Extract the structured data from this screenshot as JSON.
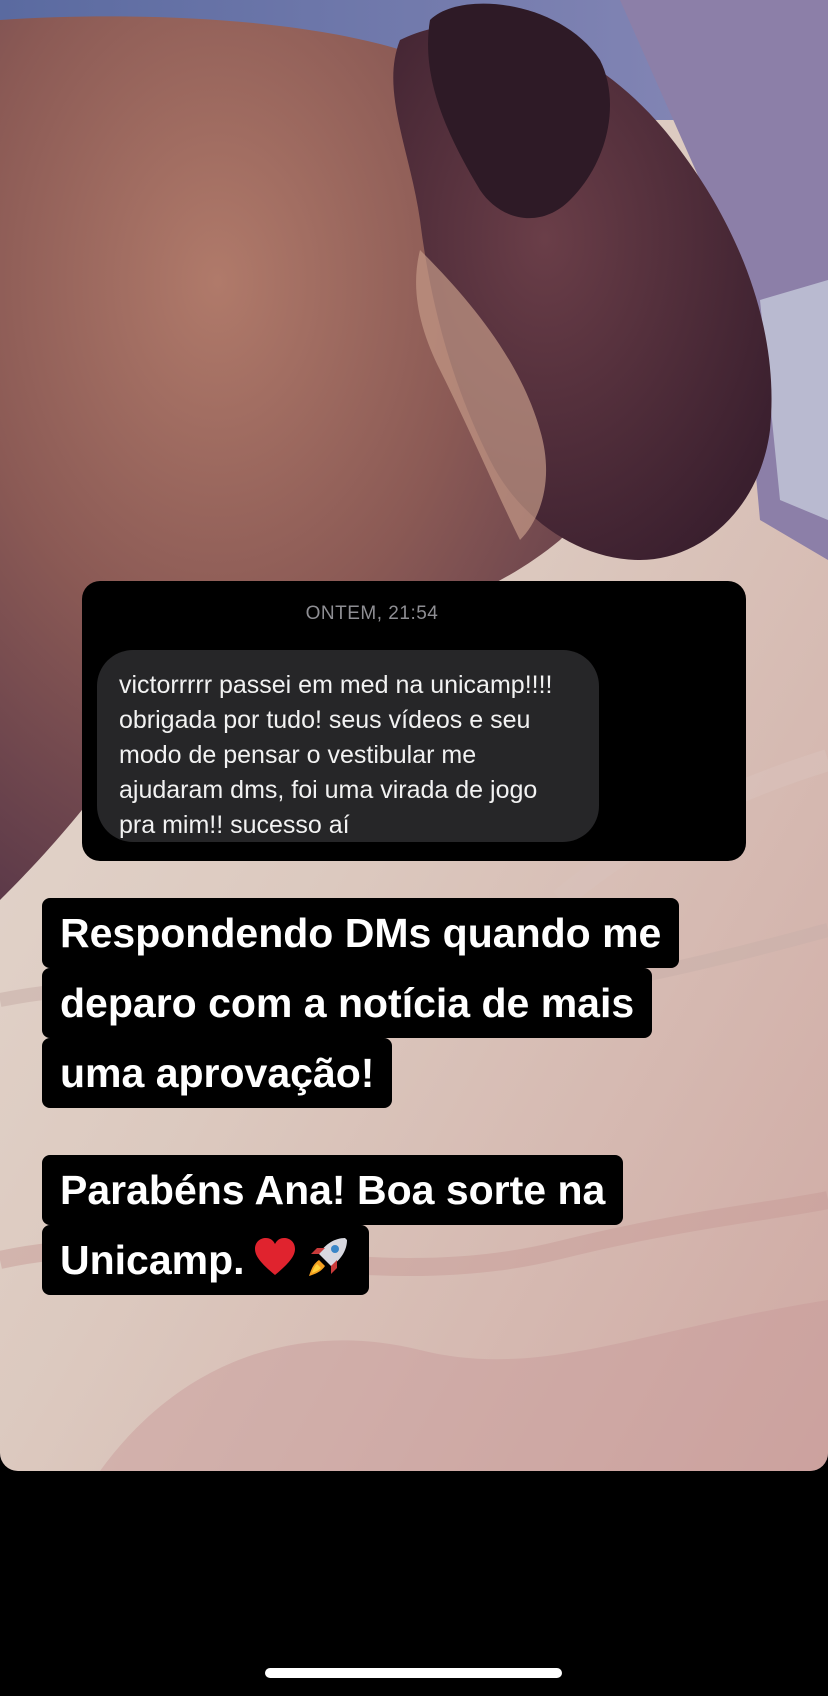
{
  "dm": {
    "timestamp": "ONTEM, 21:54",
    "message_lines": [
      "victorrrrr passei em med na unicamp!!!!",
      "obrigada por tudo! seus vídeos e seu",
      "modo de pensar o vestibular me",
      "ajudaram dms, foi uma virada de jogo",
      "pra mim!! sucesso aí"
    ]
  },
  "captions": {
    "first": [
      "Respondendo DMs quando me",
      "deparo com a notícia de mais",
      "uma aprovação!"
    ],
    "second": [
      "Parabéns Ana! Boa sorte na",
      "Unicamp."
    ],
    "second_emojis": [
      "heart-emoji",
      "rocket-emoji"
    ]
  },
  "colors": {
    "bubble": "#262628",
    "timestamp": "#8e8e93",
    "caption_bg": "#000000",
    "caption_text": "#ffffff",
    "heart": "#e0232e"
  }
}
